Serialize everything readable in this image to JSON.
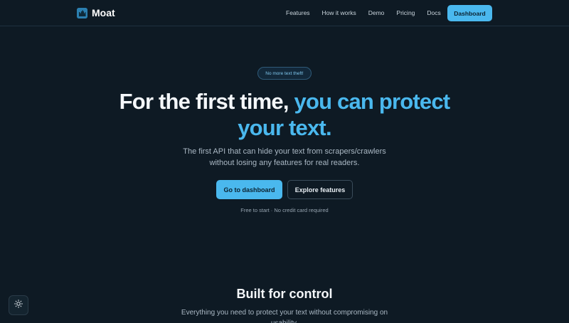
{
  "brand": {
    "name": "Moat",
    "logo_icon": "castle-icon",
    "accent": "#4ab8ee"
  },
  "nav": {
    "links": [
      "Features",
      "How it works",
      "Demo",
      "Pricing",
      "Docs"
    ],
    "cta": "Dashboard"
  },
  "hero": {
    "badge": "No more text theft!",
    "title_part1": "For the first time,",
    "title_accent_1": "you can protect",
    "title_accent_2": "your text.",
    "subtitle_line1": "The first API that can hide your text from scrapers/crawlers",
    "subtitle_line2": "without losing any features for real readers.",
    "primary_button": "Go to dashboard",
    "secondary_button": "Explore features",
    "note": "Free to start · No credit card required"
  },
  "section": {
    "title": "Built for control",
    "subtitle": "Everything you need to protect your text without compromising on usability."
  },
  "theme_toggle": {
    "icon": "sun-icon"
  }
}
